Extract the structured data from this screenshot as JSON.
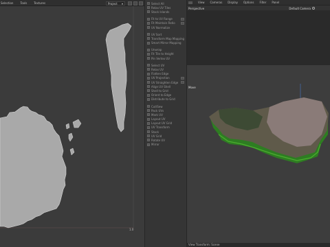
{
  "uv_editor": {
    "menu": [
      "Selection",
      "Tools",
      "Textures"
    ],
    "project_dropdown": "Project",
    "bottom_label": "1.0"
  },
  "tools_panel": {
    "items": [
      "Select All",
      "Relax UV Tiles",
      "Stack Islands",
      "Fit to UV Range",
      "Fit Maintain Ratio",
      "UV Normalize",
      "UV Sort",
      "Transform Map Mapping",
      "Smart Mirror Mapping",
      "Unwrap",
      "Fit Tile to Height",
      "Pin Vertex UV",
      "Select UV",
      "Relax UV",
      "Flatten Edge",
      "UV Projection",
      "UV Straighten Edge",
      "Align UV Shell",
      "Shell to Grid",
      "Orient to Edge",
      "Distribute to Grid",
      "Cut/Sew",
      "Pack UVs",
      "Mark UV",
      "Layout UV",
      "Layout UV Grid",
      "UV Transform",
      "Stack",
      "UV Grid",
      "Rotate UV",
      "Mirror"
    ]
  },
  "viewport": {
    "menu": [
      "View",
      "Cameras",
      "Display",
      "Options",
      "Filter",
      "Panel"
    ],
    "perspective_label": "Perspective",
    "camera_label": "Default Camera",
    "move_label": "Move ",
    "status_label": "View Transform: Scene"
  }
}
